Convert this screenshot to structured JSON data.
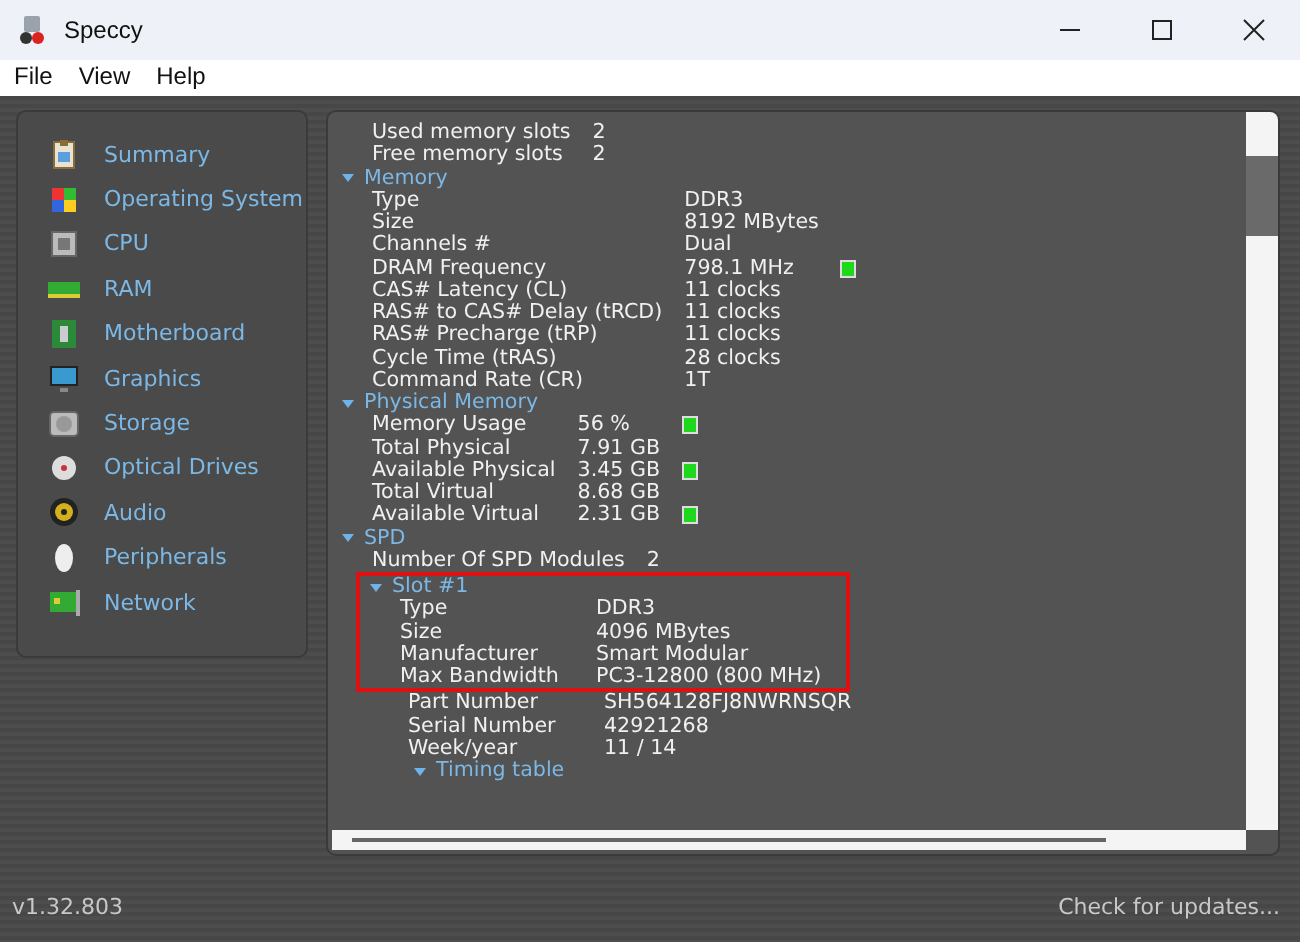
{
  "window": {
    "title": "Speccy"
  },
  "menu": [
    "File",
    "View",
    "Help"
  ],
  "sidebar": {
    "items": [
      {
        "label": "Summary"
      },
      {
        "label": "Operating System"
      },
      {
        "label": "CPU"
      },
      {
        "label": "RAM"
      },
      {
        "label": "Motherboard"
      },
      {
        "label": "Graphics"
      },
      {
        "label": "Storage"
      },
      {
        "label": "Optical Drives"
      },
      {
        "label": "Audio"
      },
      {
        "label": "Peripherals"
      },
      {
        "label": "Network"
      }
    ]
  },
  "content": {
    "top_rows": [
      {
        "label": "Used memory slots",
        "value": "2",
        "indicator": false
      },
      {
        "label": "Free memory slots",
        "value": "2",
        "indicator": false
      }
    ],
    "sections": [
      {
        "title": "Memory",
        "expanded": true,
        "rows": [
          {
            "label": "Type",
            "value": "DDR3",
            "indicator": false
          },
          {
            "label": "Size",
            "value": "8192 MBytes",
            "indicator": false
          },
          {
            "label": "Channels #",
            "value": "Dual",
            "indicator": false
          },
          {
            "label": "DRAM Frequency",
            "value": "798.1 MHz",
            "indicator": true
          },
          {
            "label": "CAS# Latency (CL)",
            "value": "11 clocks",
            "indicator": false
          },
          {
            "label": "RAS# to CAS# Delay (tRCD)",
            "value": "11 clocks",
            "indicator": false
          },
          {
            "label": "RAS# Precharge (tRP)",
            "value": "11 clocks",
            "indicator": false
          },
          {
            "label": "Cycle Time (tRAS)",
            "value": "28 clocks",
            "indicator": false
          },
          {
            "label": "Command Rate (CR)",
            "value": "1T",
            "indicator": false
          }
        ]
      },
      {
        "title": "Physical Memory",
        "expanded": true,
        "rows": [
          {
            "label": "Memory Usage",
            "value": "56 %",
            "indicator": true
          },
          {
            "label": "Total Physical",
            "value": "7.91 GB",
            "indicator": false
          },
          {
            "label": "Available Physical",
            "value": "3.45 GB",
            "indicator": true
          },
          {
            "label": "Total Virtual",
            "value": "8.68 GB",
            "indicator": false
          },
          {
            "label": "Available Virtual",
            "value": "2.31 GB",
            "indicator": true
          }
        ]
      },
      {
        "title": "SPD",
        "expanded": true,
        "rows": [
          {
            "label": "Number Of SPD Modules",
            "value": "2",
            "indicator": false
          }
        ],
        "subsections": [
          {
            "title": "Slot #1",
            "expanded": true,
            "highlighted": true,
            "rows": [
              {
                "label": "Type",
                "value": "DDR3",
                "indicator": false
              },
              {
                "label": "Size",
                "value": "4096 MBytes",
                "indicator": false
              },
              {
                "label": "Manufacturer",
                "value": "Smart Modular",
                "indicator": false
              },
              {
                "label": "Max Bandwidth",
                "value": "PC3-12800 (800 MHz)",
                "indicator": false
              }
            ],
            "extra_rows": [
              {
                "label": "Part Number",
                "value": "SH564128FJ8NWRNSQR",
                "indicator": false
              },
              {
                "label": "Serial Number",
                "value": "42921268",
                "indicator": false
              },
              {
                "label": "Week/year",
                "value": "11 / 14",
                "indicator": false
              }
            ],
            "children": [
              {
                "title": "Timing table",
                "expanded": true
              }
            ]
          }
        ]
      }
    ]
  },
  "footer": {
    "version": "v1.32.803",
    "link": "Check for updates..."
  }
}
